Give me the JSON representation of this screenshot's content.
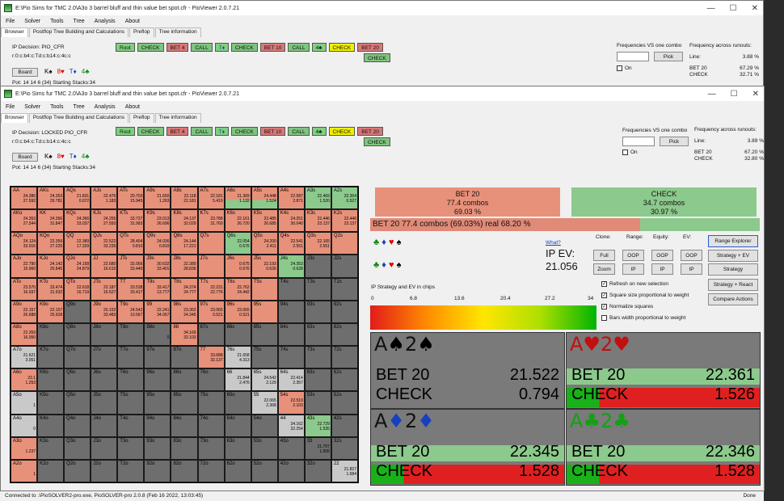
{
  "back_window": {
    "title": "E:\\Pio Sims for TMC 2.0\\A3o 3 barrel bluff and thin value bet spot.cfr - PioViewer 2.0.7.21",
    "menu": [
      "File",
      "Solver",
      "Tools",
      "Tree",
      "Analysis",
      "About"
    ],
    "tabs": [
      "Browser",
      "Postflop Tree Building and Calculations",
      "Preflop",
      "Tree information"
    ],
    "ip_decision": "IP Decision:  PIO_CFR",
    "board_str": "r:0:c:b4:c:Td:c:b14:c:4c:c",
    "board_btn": "Board",
    "board_cards": [
      "K♠",
      "8♥",
      "T♦",
      "4♣"
    ],
    "pot": "Pot: 14 14 6 (34) Starting Stacks:34",
    "crumbs": [
      "Root",
      "CHECK",
      "BET 4",
      "CALL",
      "T♦",
      "CHECK",
      "BET 10",
      "CALL",
      "4♣",
      "CHECK",
      "BET 20"
    ],
    "crumb_below": "CHECK",
    "freq_vs_combo": "Frequencies VS one combo",
    "freq_across": "Frequency across runouts:",
    "pick": "Pick",
    "on": "On",
    "line": "Line:",
    "line_val": "3.88 %",
    "bet20": "BET 20",
    "bet20_val": "67.29 %",
    "check": "CHECK",
    "check_val": "32.71 %"
  },
  "front_window": {
    "title": "E:\\Pio Sims fur TMC 2.0\\A3o 3 barrel bluff and thin value bet spot.cfr - PioViewer 2.0.7.21",
    "menu": [
      "File",
      "Solver",
      "Tools",
      "Tree",
      "Analysis",
      "About"
    ],
    "tabs": [
      "Browser",
      "Postflop Tree Building and Calculations",
      "Preflop",
      "Tree information"
    ],
    "ip_decision": "IP Decision:  LOCKED PIO_CFR",
    "board_str": "r:0:c:b4:c:Td:c:b14:c:4c:c",
    "board_btn": "Board",
    "board_cards": [
      "K♠",
      "8♥",
      "T♦",
      "4♣"
    ],
    "pot": "Pot: 14 14 6 (34) Starting Stacks:34",
    "crumbs": [
      "Root",
      "CHECK",
      "BET 4",
      "CALL",
      "T♦",
      "CHECK",
      "BET 10",
      "CALL",
      "4♣",
      "CHECK",
      "BET 20"
    ],
    "crumb_below": "CHECK",
    "freq_vs_combo": "Frequencies VS one combo",
    "freq_across": "Frequency across runouts:",
    "pick": "Pick",
    "on": "On",
    "line": "Line:",
    "line_val": "3.89 %",
    "bet20": "BET 20",
    "bet20_val": "67.20 %",
    "check": "CHECK",
    "check_val": "32.80 %"
  },
  "hand_grid": [
    [
      "AA",
      "AKs",
      "AQs",
      "AJs",
      "ATs",
      "A9s",
      "A8s",
      "A7s",
      "A6s",
      "A5s",
      "A4s",
      "A3s",
      "A2s"
    ],
    [
      "AKo",
      "KK",
      "KQs",
      "KJs",
      "KTs",
      "K9s",
      "K8s",
      "K7s",
      "K6s",
      "K5s",
      "K4s",
      "K3s",
      "K2s"
    ],
    [
      "AQo",
      "KQo",
      "QQ",
      "QJs",
      "QTs",
      "Q9s",
      "Q8s",
      "Q7s",
      "Q6s",
      "Q5s",
      "Q4s",
      "Q3s",
      "Q2s"
    ],
    [
      "AJo",
      "KJo",
      "QJo",
      "JJ",
      "JTs",
      "J9s",
      "J8s",
      "J7s",
      "J6s",
      "J5s",
      "J4s",
      "J3s",
      "J2s"
    ],
    [
      "ATo",
      "KTo",
      "QTo",
      "JTo",
      "TT",
      "T9s",
      "T8s",
      "T7s",
      "T6s",
      "T5s",
      "T4s",
      "T3s",
      "T2s"
    ],
    [
      "A9o",
      "K9o",
      "Q9o",
      "J9o",
      "T9o",
      "99",
      "98s",
      "97s",
      "96s",
      "95s",
      "94s",
      "93s",
      "92s"
    ],
    [
      "A8o",
      "K8o",
      "Q8o",
      "J8o",
      "T8o",
      "98o",
      "88",
      "87s",
      "86s",
      "85s",
      "84s",
      "83s",
      "82s"
    ],
    [
      "A7o",
      "K7o",
      "Q7o",
      "J7o",
      "T7o",
      "97o",
      "87o",
      "77",
      "76s",
      "75s",
      "74s",
      "73s",
      "72s"
    ],
    [
      "A6o",
      "K6o",
      "Q6o",
      "J6o",
      "T6o",
      "96o",
      "86o",
      "76o",
      "66",
      "65s",
      "64s",
      "63s",
      "62s"
    ],
    [
      "A5o",
      "K5o",
      "Q5o",
      "J5o",
      "T5o",
      "95o",
      "85o",
      "75o",
      "65o",
      "55",
      "54s",
      "53s",
      "52s"
    ],
    [
      "A4o",
      "K4o",
      "Q4o",
      "J4o",
      "T4o",
      "94o",
      "84o",
      "74o",
      "64o",
      "54o",
      "44",
      "43s",
      "42s"
    ],
    [
      "A3o",
      "K3o",
      "Q3o",
      "J3o",
      "T3o",
      "93o",
      "83o",
      "73o",
      "63o",
      "53o",
      "43o",
      "33",
      "32s"
    ],
    [
      "A2o",
      "K2o",
      "Q2o",
      "J2o",
      "T2o",
      "92o",
      "82o",
      "72o",
      "62o",
      "52o",
      "42o",
      "32o",
      "22"
    ]
  ],
  "cell_states": [
    [
      "bet",
      "bet",
      "bet",
      "bet",
      "bet",
      "bet",
      "bet",
      "bet",
      "mix",
      "mix",
      "bet",
      "chk",
      "chk"
    ],
    [
      "bet",
      "bet",
      "bet",
      "bet",
      "bet",
      "bet",
      "bet",
      "bet",
      "bet",
      "bet",
      "bet",
      "bet",
      "bet"
    ],
    [
      "bet",
      "bet",
      "bet",
      "bet",
      "bet",
      "bet",
      "bet",
      "bet",
      "chk",
      "bet",
      "bet",
      "bet",
      "bet"
    ],
    [
      "bet",
      "bet",
      "bet",
      "bet",
      "bet",
      "bet",
      "bet",
      "bet",
      "bet",
      "bet",
      "chk",
      "none",
      "none"
    ],
    [
      "bet",
      "bet",
      "bet",
      "bet",
      "bet",
      "bet",
      "bet",
      "bet",
      "bet",
      "bet",
      "none",
      "none",
      "none"
    ],
    [
      "bet",
      "bet",
      "none",
      "bet",
      "bet",
      "bet",
      "bet",
      "bet",
      "bet",
      "bet",
      "none",
      "none",
      "none"
    ],
    [
      "bet",
      "none",
      "none",
      "none",
      "none",
      "none",
      "bet",
      "none",
      "none",
      "none",
      "none",
      "none",
      "none"
    ],
    [
      "lt",
      "none",
      "none",
      "none",
      "none",
      "none",
      "none",
      "bet",
      "lt",
      "none",
      "none",
      "none",
      "none"
    ],
    [
      "bet",
      "none",
      "none",
      "none",
      "none",
      "none",
      "none",
      "none",
      "lt",
      "lt",
      "lt",
      "none",
      "none"
    ],
    [
      "lt",
      "none",
      "none",
      "none",
      "none",
      "none",
      "none",
      "none",
      "none",
      "lt",
      "bet",
      "none",
      "none"
    ],
    [
      "lt",
      "none",
      "none",
      "none",
      "none",
      "none",
      "none",
      "none",
      "none",
      "none",
      "lt",
      "chk",
      "none"
    ],
    [
      "bet",
      "none",
      "none",
      "none",
      "none",
      "none",
      "none",
      "none",
      "none",
      "none",
      "none",
      "none",
      "none"
    ],
    [
      "bet",
      "none",
      "none",
      "none",
      "none",
      "none",
      "none",
      "none",
      "none",
      "none",
      "none",
      "none",
      "lt"
    ]
  ],
  "cell_values": {
    "AA": [
      "24.386",
      "27.592"
    ],
    "AKs": [
      "24.353",
      "29.781"
    ],
    "AQs": [
      "21.831",
      "0.072"
    ],
    "AJs": [
      "22.476",
      "1.183"
    ],
    "ATs": [
      "20.703",
      "15.945"
    ],
    "A9s": [
      "21.650",
      "1.263"
    ],
    "A8s": [
      "22.118",
      "22.181"
    ],
    "A7s": [
      "22.181",
      "5.419"
    ],
    "A6s": [
      "21.369",
      "1.132"
    ],
    "A5s": [
      "24.448",
      "1.524"
    ],
    "A4s": [
      "22.587",
      "2.871"
    ],
    "A3s": [
      "22.469",
      "1.520"
    ],
    "A2s": [
      "22.354",
      "0.527"
    ],
    "AKo": [
      "24.353",
      "27.544"
    ],
    "KK": [
      "24.356",
      "31.847"
    ],
    "KQs": [
      "24.366",
      "33.037"
    ],
    "KJs": [
      "24.255",
      "27.593"
    ],
    "KTs": [
      "33.737",
      "31.993"
    ],
    "K9s": [
      "23.013",
      "26.696"
    ],
    "K8s": [
      "24.137",
      "32.029"
    ],
    "K7s": [
      "23.788",
      "31.760"
    ],
    "K6s": [
      "22.161",
      "26.720"
    ],
    "K5s": [
      "22.485",
      "26.685"
    ],
    "K4s": [
      "24.251",
      "30.040"
    ],
    "K3s": [
      "22.446",
      "23.137"
    ],
    "K2s": [
      "22.446",
      "23.137"
    ],
    "AQo": [
      "24.124",
      "33.016"
    ],
    "KQo": [
      "22.359",
      "27.225"
    ],
    "QQ": [
      "22.389",
      "17.329"
    ],
    "QJs": [
      "22.522",
      "33.235"
    ],
    "QTs": [
      "28.404",
      "0.810"
    ],
    "Q9s": [
      "24.036",
      "0.810"
    ],
    "Q8s": [
      "24.144",
      "17.221"
    ],
    "Q6s": [
      "22.054",
      "0.676"
    ],
    "Q5s": [
      "24.200",
      "2.411"
    ],
    "Q4s": [
      "22.541",
      "2.551"
    ],
    "Q3s": [
      "22.165",
      "2.551"
    ],
    "AJo": [
      "22.790",
      "15.960"
    ],
    "KJo": [
      "24.142",
      "25.845"
    ],
    "QJo": [
      "24.158",
      "24.879"
    ],
    "JJ": [
      "22.680",
      "16.615"
    ],
    "JTs": [
      "32.056",
      "33.440"
    ],
    "J9s": [
      "30.632",
      "33.401"
    ],
    "J8s": [
      "22.389",
      "28.836"
    ],
    "J6s": [
      "0.675",
      "0.676"
    ],
    "J5s": [
      "22.193",
      "0.626"
    ],
    "J4s": [
      "24.353",
      "0.628"
    ],
    "ATo": [
      "23.570",
      "16.937"
    ],
    "KTo": [
      "33.474",
      "31.932"
    ],
    "QTo": [
      "22.618",
      "16.719"
    ],
    "JTo": [
      "22.187",
      "16.527"
    ],
    "TT": [
      "33.538",
      "33.417"
    ],
    "T9s": [
      "33.417",
      "13.777"
    ],
    "T8s": [
      "24.374",
      "24.777"
    ],
    "T7s": [
      "22.231",
      "22.776"
    ],
    "T6s": [
      "22.762",
      "24.442"
    ],
    "A9o": [
      "22.157",
      "26.688"
    ],
    "K9o": [
      "22.157",
      "25.928"
    ],
    "J9o": [
      "20.152",
      "33.483"
    ],
    "T9o": [
      "24.542",
      "10.567"
    ],
    "99": [
      "22.241",
      "34.057"
    ],
    "98s": [
      "23.362",
      "24.345"
    ],
    "97s": [
      "23.065",
      "0.521"
    ],
    "96s": [
      "23.065",
      "0.521"
    ],
    "A8o": [
      "22.359",
      "16.050"
    ],
    "98o": [
      "",
      "0"
    ],
    "88": [
      "34.169",
      "32.103"
    ],
    "A7o": [
      "21.621",
      "3.051"
    ],
    "77": [
      "33.688",
      "32.137"
    ],
    "76s": [
      "21.658",
      "4.313"
    ],
    "A6o": [
      "22.1",
      "1.253"
    ],
    "66": [
      "21.844",
      "2.476"
    ],
    "65s": [
      "24.542",
      "2.129"
    ],
    "64s": [
      "22.414",
      "2.357"
    ],
    "A5o": [
      "",
      "1"
    ],
    "55": [
      "22.065",
      "2.368"
    ],
    "54s": [
      "22.519",
      "2.103"
    ],
    "A4o": [
      "",
      "0"
    ],
    "44": [
      "34.162",
      "32.254"
    ],
    "43s": [
      "22.729",
      "1.535"
    ],
    "A3o": [
      "",
      "1.237"
    ],
    "33": [
      "21.707",
      "1.505"
    ],
    "A2o": [
      "",
      "1"
    ],
    "22": [
      "21.827",
      "1.684"
    ]
  },
  "strategy_panel": {
    "bet_label": "BET 20",
    "bet_combos": "77.4 combos",
    "bet_pct": "69.03 %",
    "check_label": "CHECK",
    "check_combos": "34.7 combos",
    "check_pct": "30.97 %",
    "summary": "BET 20   77.4 combos (69.03%) real  68.20 %",
    "what": "What?",
    "ip_ev_label": "IP EV:",
    "ip_ev_val": "21.056",
    "clone": "Clone:",
    "range": "Range:",
    "equity": "Equity:",
    "ev": "EV:",
    "btn_full": "Full",
    "btn_zoom": "Zoom",
    "btn_oop1": "OOP",
    "btn_ip1": "IP",
    "btn_oop2": "OOP",
    "btn_ip2": "IP",
    "btn_oop3": "OOP",
    "btn_ip3": "IP",
    "btn_range_explorer": "Range Explorer",
    "btn_strat_ev": "Strategy + EV",
    "btn_strategy": "Strategy",
    "btn_strat_react": "Strategy + React",
    "btn_compare": "Compare Actions",
    "chk_refresh": "Refresh on new selection",
    "chk_square": "Square size proportional to weight",
    "chk_normalize": "Normalize squares",
    "chk_bars": "Bars width proportional to weight",
    "ip_strat_label": "IP Strategy and EV in chips",
    "scale": [
      "0",
      "6.8",
      "13.6",
      "20.4",
      "27.2",
      "34"
    ],
    "colors": {
      "bet": "#e8917a",
      "check": "#8cc98c",
      "red": "#e02020",
      "green": "#19b019"
    }
  },
  "combos": [
    {
      "title_rank": "A",
      "title_suit": "♠",
      "title_rank2": "2",
      "title_suit2": "♠",
      "suit_color": "black",
      "bet": "BET 20",
      "bet_ev": "21.522",
      "check": "CHECK",
      "check_ev": "0.794"
    },
    {
      "title_rank": "A",
      "title_suit": "♥",
      "title_rank2": "2",
      "title_suit2": "♥",
      "suit_color": "red",
      "bet": "BET 20",
      "bet_ev": "22.361",
      "check": "CHECK",
      "check_ev": "1.526"
    },
    {
      "title_rank": "A",
      "title_suit": "♦",
      "title_rank2": "2",
      "title_suit2": "♦",
      "suit_color": "blue",
      "bet": "BET 20",
      "bet_ev": "22.345",
      "check": "CHECK",
      "check_ev": "1.528"
    },
    {
      "title_rank": "A",
      "title_suit": "♣",
      "title_rank2": "2",
      "title_suit2": "♣",
      "suit_color": "green",
      "bet": "BET 20",
      "bet_ev": "22.346",
      "check": "CHECK",
      "check_ev": "1.528"
    }
  ],
  "status_bar": "Connected to .\\PioSOLVER2-pro.exe, PioSOLVER-pro 2.0.8 (Feb 16 2022, 13:03:45)",
  "status_done": "Done"
}
